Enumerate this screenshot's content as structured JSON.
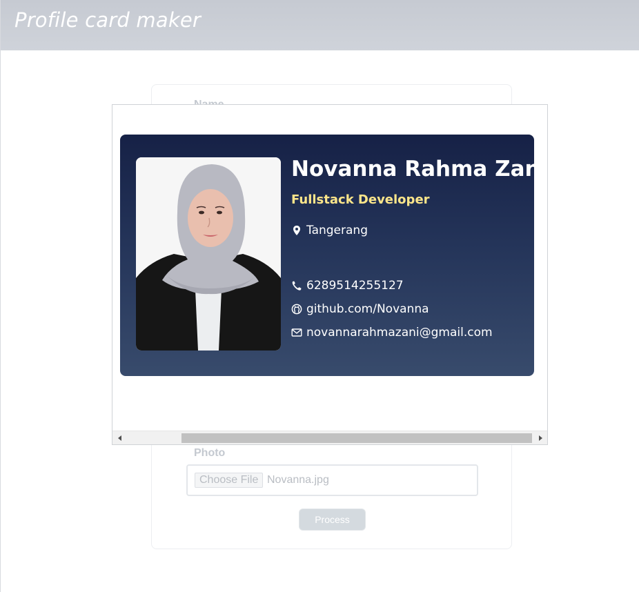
{
  "app": {
    "title": "Profile card maker"
  },
  "form": {
    "name_label": "Name",
    "photo_label": "Photo",
    "choose_file_label": "Choose File",
    "file_name": "Novanna.jpg",
    "process_label": "Process"
  },
  "card": {
    "name": "Novanna Rahma Zani",
    "role": "Fullstack Developer",
    "location": "Tangerang",
    "phone": "6289514255127",
    "github": "github.com/Novanna",
    "email": "novannarahmazani@gmail.com",
    "colors": {
      "gradient_top": "#162146",
      "gradient_bottom": "#384b6c",
      "role_text": "#fde68a",
      "text": "#ffffff"
    },
    "icons": [
      "location-pin-icon",
      "phone-icon",
      "github-icon",
      "mail-icon"
    ]
  },
  "scrollbar": {
    "scroll_position": 0.16
  }
}
